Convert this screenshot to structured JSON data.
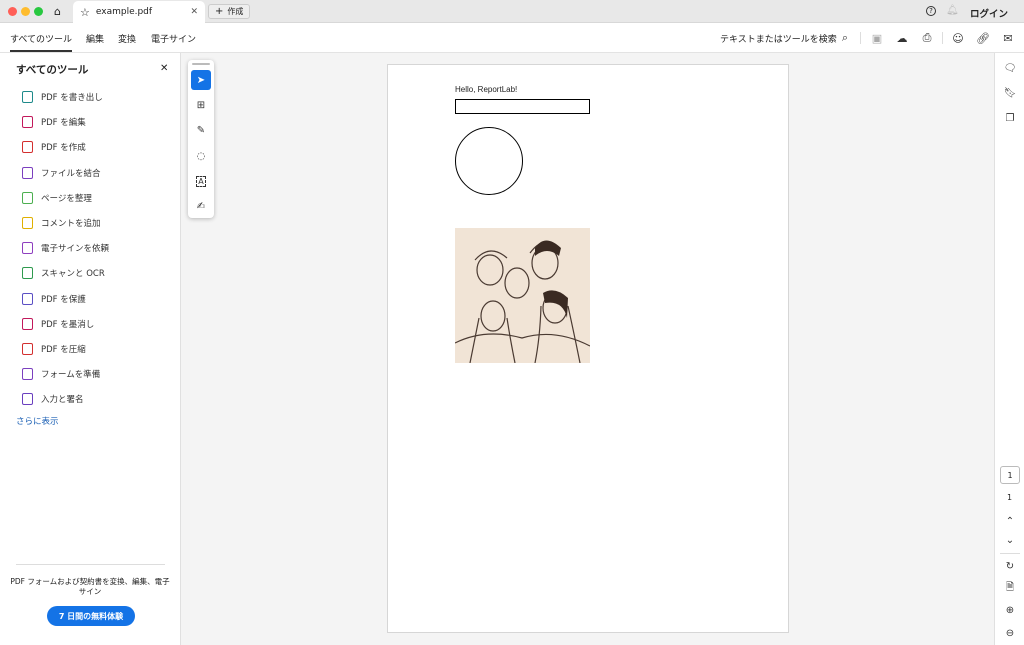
{
  "titlebar": {
    "tab_title": "example.pdf",
    "new_tab_label": "作成",
    "login_label": "ログイン"
  },
  "menu": {
    "items": [
      "すべてのツール",
      "編集",
      "変換",
      "電子サイン"
    ],
    "search_label": "テキストまたはツールを検索"
  },
  "sidebar": {
    "title": "すべてのツール",
    "items": [
      {
        "label": "PDF を書き出し",
        "color": "#1e8a8a"
      },
      {
        "label": "PDF を編集",
        "color": "#c2185b"
      },
      {
        "label": "PDF を作成",
        "color": "#d32f2f"
      },
      {
        "label": "ファイルを結合",
        "color": "#7b3fbf"
      },
      {
        "label": "ページを整理",
        "color": "#4caf50"
      },
      {
        "label": "コメントを追加",
        "color": "#e0b000"
      },
      {
        "label": "電子サインを依頼",
        "color": "#8e3fbf"
      },
      {
        "label": "スキャンと OCR",
        "color": "#2e9a4e"
      },
      {
        "label": "PDF を保護",
        "color": "#5b4fc4"
      },
      {
        "label": "PDF を墨消し",
        "color": "#c2185b"
      },
      {
        "label": "PDF を圧縮",
        "color": "#d32f2f"
      },
      {
        "label": "フォームを準備",
        "color": "#7b3fbf"
      },
      {
        "label": "入力と署名",
        "color": "#6a3fbf"
      }
    ],
    "more_label": "さらに表示",
    "promo_text": "PDF フォームおよび契約書を変換、編集、電子サイン",
    "trial_button": "7 日間の無料体験"
  },
  "document": {
    "text": "Hello, ReportLab!"
  },
  "pager": {
    "current_page": "1",
    "total_pages": "1"
  },
  "accent": "#1473e6"
}
